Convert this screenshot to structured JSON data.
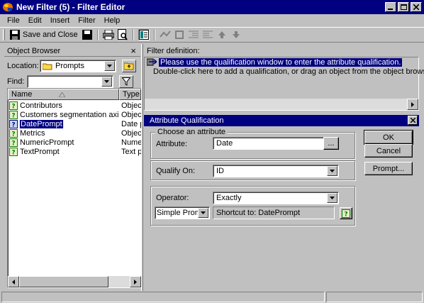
{
  "window": {
    "title": "New Filter (5) - Filter Editor"
  },
  "menu": [
    "File",
    "Edit",
    "Insert",
    "Filter",
    "Help"
  ],
  "toolbar": {
    "save_close_label": "Save and Close"
  },
  "object_browser": {
    "title": "Object Browser",
    "close_glyph": "×",
    "location_label": "Location:",
    "location_value": "Prompts",
    "find_label": "Find:",
    "find_value": "",
    "columns": [
      "Name",
      "Type"
    ],
    "items": [
      {
        "name": "Contributors",
        "type": "Object",
        "icon": "prompt-icon",
        "selected": false
      },
      {
        "name": "Customers segmentation axis",
        "type": "Object",
        "icon": "prompt-icon",
        "selected": false
      },
      {
        "name": "DatePrompt",
        "type": "Date p",
        "icon": "date-prompt-icon",
        "selected": true
      },
      {
        "name": "Metrics",
        "type": "Object",
        "icon": "prompt-icon",
        "selected": false
      },
      {
        "name": "NumericPrompt",
        "type": "Numer",
        "icon": "prompt-icon",
        "selected": false
      },
      {
        "name": "TextPrompt",
        "type": "Text p",
        "icon": "prompt-icon",
        "selected": false
      }
    ]
  },
  "filter_definition": {
    "label": "Filter definition:",
    "lines": [
      "Please use the qualification window to enter the attribute qualification.",
      "Double-click here to add a qualification, or drag an object from the object browse"
    ]
  },
  "attribute_qualification": {
    "title": "Attribute Qualification",
    "close_glyph": "×",
    "group_label": "Choose an attribute",
    "attribute_label": "Attribute:",
    "attribute_value": "Date",
    "browse_label": "...",
    "qualify_on_label": "Qualify On:",
    "qualify_on_value": "ID",
    "operator_label": "Operator:",
    "operator_value": "Exactly",
    "value_type": "Simple Prom",
    "value_text": "Shortcut to: DatePrompt",
    "ok_label": "OK",
    "cancel_label": "Cancel",
    "prompt_label": "Prompt..."
  },
  "colors": {
    "titlebar": "#000080",
    "face": "#c0c0c0",
    "selection": "#000080"
  }
}
